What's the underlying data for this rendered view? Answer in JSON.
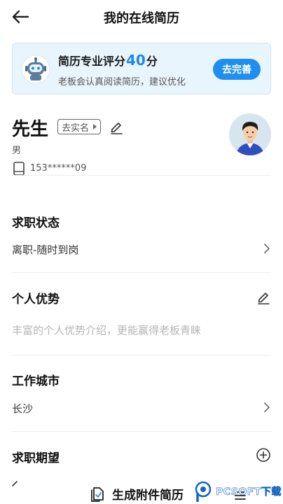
{
  "header": {
    "title": "我的在线简历"
  },
  "score_card": {
    "title_prefix": "简历专业评分",
    "score": "40",
    "title_suffix": "分",
    "subtitle": "老板会认真阅读简历，建议优化",
    "button_label": "去完善"
  },
  "profile": {
    "name": "先生",
    "verify_label": "去实名",
    "gender": "男",
    "phone": "153******09"
  },
  "sections": {
    "job_status": {
      "title": "求职状态",
      "value": "离职-随时到岗"
    },
    "advantage": {
      "title": "个人优势",
      "placeholder": "丰富的个人优势介绍，更能赢得老板青睐"
    },
    "work_city": {
      "title": "工作城市",
      "value": "长沙"
    },
    "expectation": {
      "title": "求职期望"
    }
  },
  "bottom": {
    "generate_label": "生成附件简历",
    "watermark": "PCSOFT下载"
  },
  "colors": {
    "accent": "#1e8ff0",
    "card_bg": "#e9f5fd",
    "placeholder": "#b5b5b5"
  }
}
